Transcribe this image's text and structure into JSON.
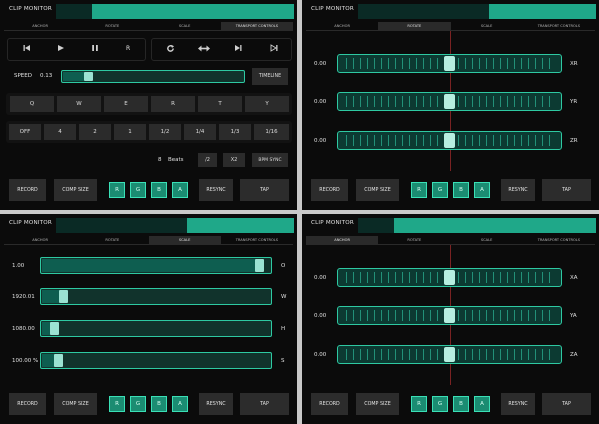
{
  "title": "CLIP MONITOR",
  "tabs": [
    "ANCHOR",
    "ROTATE",
    "SCALE",
    "TRANSPORT CONTROLS"
  ],
  "bottom": {
    "record": "RECORD",
    "comp_size": "COMP SIZE",
    "channels": [
      "R",
      "G",
      "B",
      "A"
    ],
    "resync": "RESYNC",
    "tap": "TAP"
  },
  "transport": {
    "header_fill": 0.85,
    "reverse_label": "R",
    "speed_label": "SPEED",
    "speed_value": "0.13",
    "speed_fraction": 0.13,
    "timeline": "TIMELINE",
    "keys": [
      "Q",
      "W",
      "E",
      "R",
      "T",
      "Y"
    ],
    "rates": [
      "OFF",
      "4",
      "2",
      "1",
      "1/2",
      "1/4",
      "1/3",
      "1/16"
    ],
    "beats_count": "8",
    "beats_label": "Beats",
    "half_btn": "/2",
    "double_btn": "X2",
    "bpm_sync": "BPM SYNC",
    "icons": [
      "rewind-icon",
      "play-icon",
      "pause-icon",
      "loop-icon",
      "ping-pong-icon",
      "skip-forward-icon",
      "skip-end-icon"
    ]
  },
  "rotate": {
    "header_fill": 0.45,
    "rows": [
      {
        "value": "0.00",
        "axis": "XR",
        "fraction": 0.5
      },
      {
        "value": "0.00",
        "axis": "YR",
        "fraction": 0.5
      },
      {
        "value": "0.00",
        "axis": "ZR",
        "fraction": 0.5
      }
    ]
  },
  "scale": {
    "header_fill": 0.45,
    "rows": [
      {
        "value": "1.00",
        "axis": "O",
        "fraction": 0.97
      },
      {
        "value": "1920.01",
        "axis": "W",
        "fraction": 0.08
      },
      {
        "value": "1080.00",
        "axis": "H",
        "fraction": 0.04
      },
      {
        "value": "100.00 %",
        "axis": "S",
        "fraction": 0.06
      }
    ]
  },
  "anchor": {
    "header_fill": 0.85,
    "rows": [
      {
        "value": "0.00",
        "axis": "XA",
        "fraction": 0.5
      },
      {
        "value": "0.00",
        "axis": "YA",
        "fraction": 0.5
      },
      {
        "value": "0.00",
        "axis": "ZA",
        "fraction": 0.5
      }
    ]
  },
  "colors": {
    "accent": "#1fa889",
    "bright": "#2ec9a2",
    "track": "#0c3a32",
    "marker": "#7a2222"
  }
}
